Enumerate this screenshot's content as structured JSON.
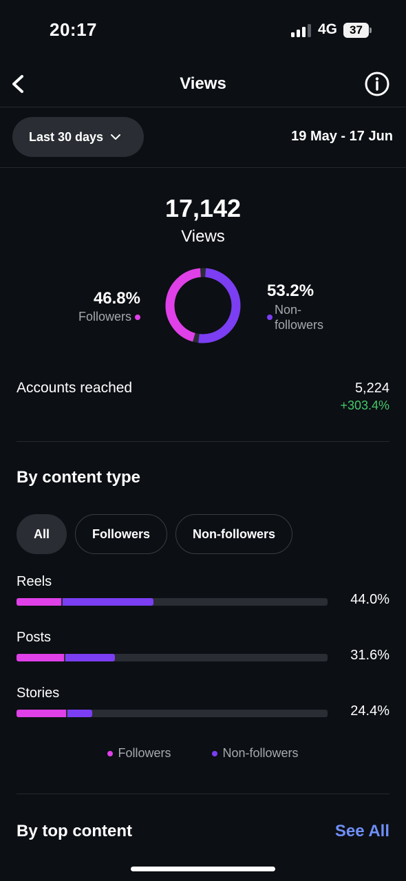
{
  "status_bar": {
    "time": "20:17",
    "network": "4G",
    "battery": "37"
  },
  "header": {
    "title": "Views",
    "back_icon": "chevron-left-icon",
    "info_icon": "info-icon"
  },
  "date_filter": {
    "range_label": "Last 30 days",
    "date_range": "19 May - 17 Jun"
  },
  "summary": {
    "total": "17,142",
    "label": "Views",
    "followers_pct": "46.8%",
    "followers_label": "Followers",
    "nonfollowers_pct": "53.2%",
    "nonfollowers_label": "Non-followers",
    "followers_fraction": 0.468
  },
  "accounts_reached": {
    "label": "Accounts reached",
    "value": "5,224",
    "change": "+303.4%"
  },
  "content_type": {
    "title": "By content type",
    "filters": [
      "All",
      "Followers",
      "Non-followers"
    ],
    "active_filter": "All",
    "rows": [
      {
        "label": "Reels",
        "pct": "44.0%",
        "followers_share": 0.148,
        "nonfollowers_share": 0.292
      },
      {
        "label": "Posts",
        "pct": "31.6%",
        "followers_share": 0.156,
        "nonfollowers_share": 0.16
      },
      {
        "label": "Stories",
        "pct": "24.4%",
        "followers_share": 0.164,
        "nonfollowers_share": 0.08
      }
    ],
    "legend": {
      "followers": "Followers",
      "nonfollowers": "Non-followers"
    }
  },
  "top_content": {
    "title": "By top content",
    "see_all": "See All"
  },
  "colors": {
    "followers": "#e040e8",
    "nonfollowers": "#7b3ef2",
    "positive": "#44c86b",
    "link": "#6f8ff7"
  }
}
